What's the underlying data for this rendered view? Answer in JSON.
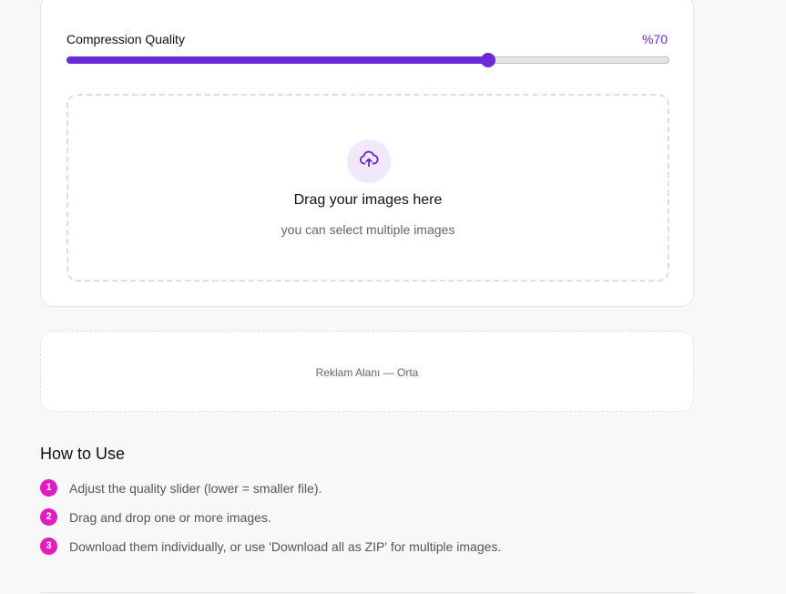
{
  "compressor": {
    "quality_label": "Compression Quality",
    "quality_value_text": "%70",
    "quality_percent": 70,
    "accent_color": "#6d28d9"
  },
  "dropzone": {
    "icon": "cloud-upload-icon",
    "title": "Drag your images here",
    "subtitle": "you can select multiple images"
  },
  "ad": {
    "text": "Reklam Alanı — Orta"
  },
  "how_to": {
    "title": "How to Use",
    "badge_color": "#e11dbf",
    "steps": [
      {
        "num": "1",
        "text": "Adjust the quality slider (lower = smaller file)."
      },
      {
        "num": "2",
        "text": "Drag and drop one or more images."
      },
      {
        "num": "3",
        "text": "Download them individually, or use 'Download all as ZIP' for multiple images."
      }
    ]
  }
}
